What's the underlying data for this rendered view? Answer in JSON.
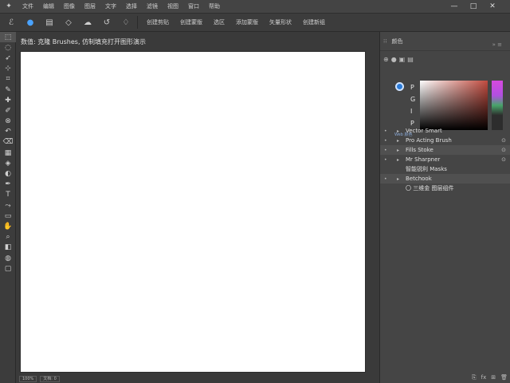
{
  "menubar": {
    "logo_icon": "app-logo-icon",
    "items": [
      "文件",
      "编辑",
      "图像",
      "图层",
      "文字",
      "选择",
      "滤镜",
      "视图",
      "窗口",
      "帮助"
    ],
    "window_controls": [
      "—",
      "□",
      "✕"
    ]
  },
  "options_bar": {
    "tools": [
      {
        "icon": "lasso-icon",
        "glyph": "ℰ"
      },
      {
        "icon": "brush-icon",
        "glyph": "●"
      },
      {
        "icon": "layer-icon",
        "glyph": "▤"
      },
      {
        "icon": "tag-icon",
        "glyph": "◇"
      },
      {
        "icon": "cloud-icon",
        "glyph": "☁"
      },
      {
        "icon": "rotate-icon",
        "glyph": "↺"
      },
      {
        "icon": "bucket-icon",
        "glyph": "♢"
      }
    ],
    "buttons": [
      "创建剪贴",
      "创建蒙版",
      "选区",
      "添加蒙版",
      "矢量形状",
      "创建新组"
    ]
  },
  "toolbar": {
    "tools": [
      "move-icon",
      "marquee-icon",
      "lasso-icon",
      "magic-wand-icon",
      "crop-icon",
      "eyedropper-icon",
      "healing-icon",
      "brush-icon",
      "clone-icon",
      "history-icon",
      "eraser-icon",
      "gradient-icon",
      "blur-icon",
      "dodge-icon",
      "pen-icon",
      "text-icon",
      "path-icon",
      "shape-icon",
      "hand-icon",
      "zoom-icon",
      "color-icon",
      "mask-icon",
      "screen-icon"
    ],
    "glyphs": [
      "⬚",
      "◌",
      "➶",
      "⊹",
      "⌗",
      "✎",
      "✚",
      "✐",
      "⊗",
      "↶",
      "⌫",
      "▦",
      "◈",
      "◐",
      "✒",
      "T",
      "⤳",
      "▭",
      "✋",
      "⌕",
      "◧",
      "◍",
      "▢"
    ]
  },
  "document": {
    "info": "数值: 克隆 Brushes, 仿制填充打开图形演示"
  },
  "status_bar": {
    "items": [
      "100%",
      "文档: 0"
    ]
  },
  "right_panel": {
    "header": "颜色",
    "channels": [
      "P",
      "G",
      "I",
      "P"
    ],
    "caption": "Web 颜色",
    "layers": [
      {
        "name": "Vector Smart",
        "alt": false,
        "sub": false,
        "lock": false
      },
      {
        "name": "Pro Acting Brush",
        "alt": false,
        "sub": false,
        "lock": true
      },
      {
        "name": "Fills Stoke",
        "alt": true,
        "sub": false,
        "lock": true
      },
      {
        "name": "Mr Sharpner",
        "alt": false,
        "sub": false,
        "lock": true
      },
      {
        "name": "智能锐利 Masks",
        "alt": false,
        "sub": true,
        "lock": false
      },
      {
        "name": "Betchook",
        "alt": true,
        "sub": false,
        "lock": false
      },
      {
        "name": "〇 三维金 图层组件",
        "alt": false,
        "sub": true,
        "lock": false
      }
    ],
    "footer_icons": [
      "link-icon",
      "fx-icon",
      "new-layer-icon",
      "trash-icon"
    ],
    "footer_glyphs": [
      "⎘",
      "fx",
      "⊞",
      "🗑"
    ]
  },
  "colors": {
    "accent": "#2b7bd8",
    "canvas": "#ffffff",
    "bg": "#3a3a3a"
  }
}
